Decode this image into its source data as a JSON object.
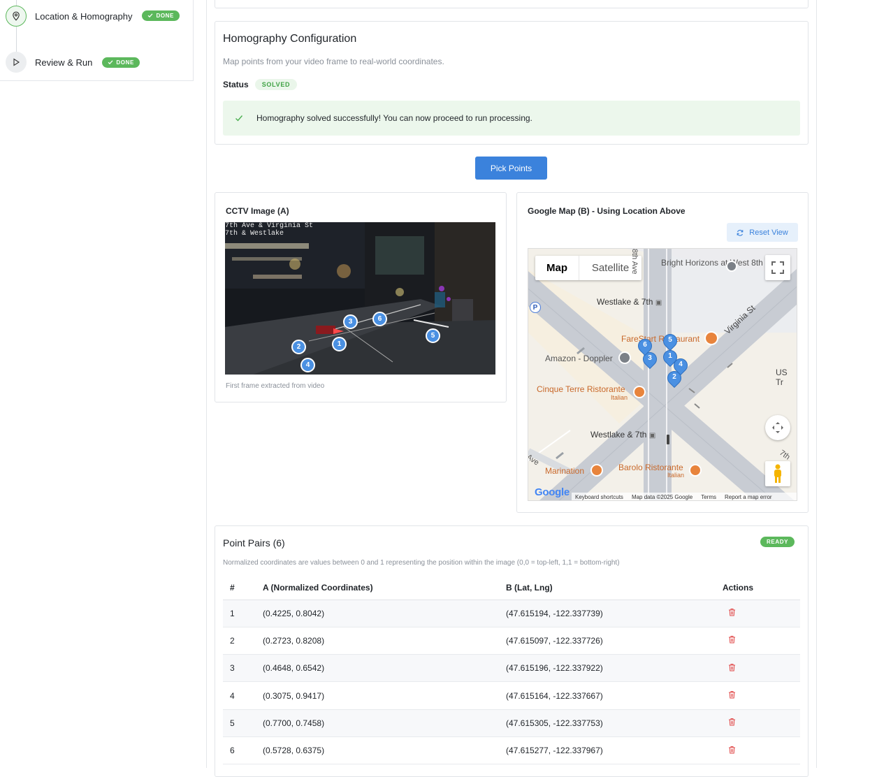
{
  "sidebar": {
    "steps": [
      {
        "label": "Location & Homography",
        "badge": "DONE"
      },
      {
        "label": "Review & Run",
        "badge": "DONE"
      }
    ]
  },
  "homography": {
    "title": "Homography Configuration",
    "description": "Map points from your video frame to real-world coordinates.",
    "status_label": "Status",
    "status_value": "SOLVED",
    "success_message": "Homography solved successfully! You can now proceed to run processing."
  },
  "pick_points_label": "Pick Points",
  "cctv": {
    "title": "CCTV Image (A)",
    "overlay_line1": "7th Ave & Virginia St",
    "overlay_line2": "7th & Westlake",
    "caption": "First frame extracted from video",
    "points": [
      "1",
      "2",
      "3",
      "4",
      "5",
      "6"
    ]
  },
  "map": {
    "title": "Google Map (B) - Using Location Above",
    "reset_label": "Reset View",
    "tab_map": "Map",
    "tab_satellite": "Satellite",
    "labels": {
      "bright_horizons": "Bright Horizons at West 8th",
      "westlake_top": "Westlake & 7th",
      "farestart": "FareStart Restaurant",
      "amazon": "Amazon - Doppler",
      "cinque": "Cinque Terre Ristorante",
      "cinque_sub": "Italian",
      "westlake_bottom": "Westlake & 7th",
      "marination": "Marination",
      "barolo": "Barolo Ristorante",
      "barolo_sub": "Italian",
      "virginia": "Virginia St",
      "us_tr": "US Tr",
      "ave_left": "Ave",
      "ave_top": "8th Ave",
      "seventh": "7th",
      "parking": "P"
    },
    "footer": {
      "google": "Google",
      "shortcuts": "Keyboard shortcuts",
      "mapdata": "Map data ©2025 Google",
      "terms": "Terms",
      "report": "Report a map error"
    },
    "pins": [
      "1",
      "2",
      "3",
      "4",
      "5",
      "6"
    ]
  },
  "pairs": {
    "title": "Point Pairs (6)",
    "badge": "READY",
    "note": "Normalized coordinates are values between 0 and 1 representing the position within the image (0,0 = top-left, 1,1 = bottom-right)",
    "headers": [
      "#",
      "A (Normalized Coordinates)",
      "B (Lat, Lng)",
      "Actions"
    ],
    "rows": [
      {
        "n": "1",
        "a": "(0.4225, 0.8042)",
        "b": "(47.615194, -122.337739)"
      },
      {
        "n": "2",
        "a": "(0.2723, 0.8208)",
        "b": "(47.615097, -122.337726)"
      },
      {
        "n": "3",
        "a": "(0.4648, 0.6542)",
        "b": "(47.615196, -122.337922)"
      },
      {
        "n": "4",
        "a": "(0.3075, 0.9417)",
        "b": "(47.615164, -122.337667)"
      },
      {
        "n": "5",
        "a": "(0.7700, 0.7458)",
        "b": "(47.615305, -122.337753)"
      },
      {
        "n": "6",
        "a": "(0.5728, 0.6375)",
        "b": "(47.615277, -122.337967)"
      }
    ]
  },
  "colors": {
    "accent": "#3b82dc",
    "success": "#5cb85c",
    "danger": "#e04848"
  }
}
